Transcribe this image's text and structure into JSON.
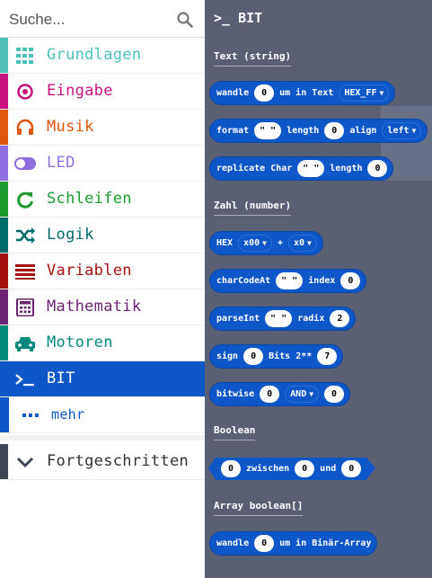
{
  "search": {
    "placeholder": "Suche..."
  },
  "categories": [
    {
      "label": "Grundlagen",
      "color": "#4cbfb9",
      "icon": "grid-icon"
    },
    {
      "label": "Eingabe",
      "color": "#c8137e",
      "icon": "target-icon"
    },
    {
      "label": "Musik",
      "color": "#e1560d",
      "icon": "headphones-icon"
    },
    {
      "label": "LED",
      "color": "#8d6fe0",
      "icon": "toggle-icon"
    },
    {
      "label": "Schleifen",
      "color": "#1d9a2e",
      "icon": "loop-icon"
    },
    {
      "label": "Logik",
      "color": "#006a6a",
      "icon": "shuffle-icon"
    },
    {
      "label": "Variablen",
      "color": "#a3120f",
      "icon": "lines-icon"
    },
    {
      "label": "Mathematik",
      "color": "#6c2472",
      "icon": "calculator-icon"
    },
    {
      "label": "Motoren",
      "color": "#00897b",
      "icon": "car-icon"
    },
    {
      "label": "BIT",
      "color": "#0d57c9",
      "icon": "terminal-icon"
    },
    {
      "label": "mehr",
      "color": "#0d57c9",
      "icon": "dots-icon"
    },
    {
      "label": "Fortgeschritten",
      "color": "#3d4555",
      "icon": "chevron-down-icon"
    }
  ],
  "flyout": {
    "title": "BIT",
    "sections": {
      "text": "Text (string)",
      "zahl": "Zahl (number)",
      "boolean": "Boolean",
      "array": "Array boolean[]"
    },
    "blocks": {
      "wandle1": {
        "a": "wandle",
        "v": "0",
        "b": "um in Text",
        "dd": "HEX_FF"
      },
      "format": {
        "a": "format",
        "v1": "\" \"",
        "b": "length",
        "v2": "0",
        "c": "align",
        "dd": "left"
      },
      "replicate": {
        "a": "replicate Char",
        "v1": "\" \"",
        "b": "length",
        "v2": "0"
      },
      "hex": {
        "a": "HEX",
        "dd1": "x00",
        "plus": "+",
        "dd2": "x0"
      },
      "charcode": {
        "a": "charCodeAt",
        "v1": "\" \"",
        "b": "index",
        "v2": "0"
      },
      "parseint": {
        "a": "parseInt",
        "v1": "\" \"",
        "b": "radix",
        "v2": "2"
      },
      "sign": {
        "a": "sign",
        "v1": "0",
        "b": "Bits 2**",
        "v2": "7"
      },
      "bitwise": {
        "a": "bitwise",
        "v1": "0",
        "dd": "AND",
        "v2": "0"
      },
      "zwischen": {
        "v1": "0",
        "a": "zwischen",
        "v2": "0",
        "b": "und",
        "v3": "0"
      },
      "wandle2": {
        "a": "wandle",
        "v": "0",
        "b": "um in Binär-Array"
      }
    }
  }
}
